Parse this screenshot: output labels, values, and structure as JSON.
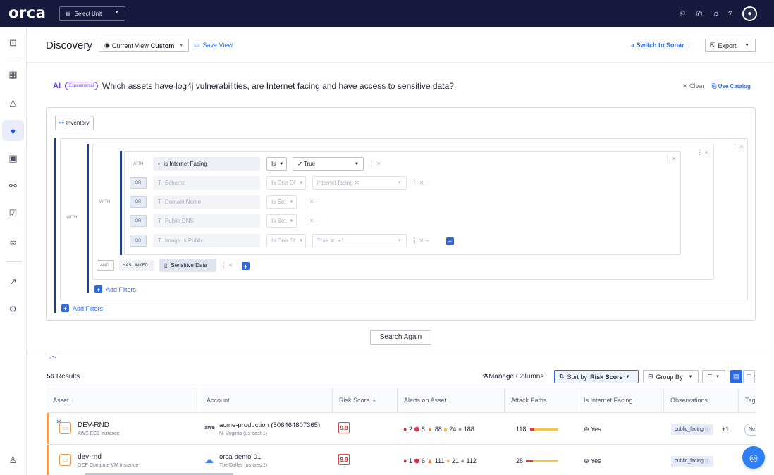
{
  "topbar": {
    "logo": "orca",
    "unit_select": "Select Unit",
    "icons": [
      "flag-icon",
      "megaphone-icon",
      "bell-icon",
      "help-icon",
      "user-avatar-icon"
    ]
  },
  "sidebar": {
    "items": [
      "lock-icon",
      "dashboard-icon",
      "alert-icon",
      "discovery-icon",
      "compliance-icon",
      "graph-icon",
      "clipboard-check-icon",
      "glasses-icon",
      "integrations-icon",
      "settings-icon",
      "user-settings-icon"
    ]
  },
  "header": {
    "title": "Discovery",
    "current_view_label": "Current View",
    "current_view_value": "Custom",
    "save_view": "Save View",
    "switch_to_sonar": "Switch to Sonar",
    "export": "Export"
  },
  "ai": {
    "label": "AI",
    "badge": "Experimental",
    "question": "Which assets have log4j vulnerabilities, are Internet facing and have access to sensitive data?",
    "clear": "Clear",
    "use_catalog": "Use Catalog"
  },
  "filters": {
    "inventory": "Inventory",
    "with": "WITH",
    "or": "OR",
    "and": "AND",
    "has_linked": "HAS LINKED",
    "rows": [
      {
        "field": "Is Internet Facing",
        "operator": "Is",
        "value": "True"
      },
      {
        "field": "Scheme",
        "operator": "Is One Of",
        "value": "internet-facing"
      },
      {
        "field": "Domain Name",
        "operator": "Is Set"
      },
      {
        "field": "Public DNS",
        "operator": "Is Set"
      },
      {
        "field": "Image Is Public",
        "operator": "Is One Of",
        "value": "True",
        "extra": "+1"
      }
    ],
    "linked": "Sensitive Data",
    "add_filters": "Add Filters",
    "search_again": "Search Again"
  },
  "results": {
    "count": "56",
    "label": "Results",
    "manage_columns": "Manage Columns",
    "sort_by_label": "Sort by",
    "sort_by_value": "Risk Score",
    "group_by": "Group By"
  },
  "table": {
    "columns": [
      "Asset",
      "Account",
      "Risk Score",
      "Alerts on Asset",
      "Attack Paths",
      "Is Internet Facing",
      "Observations",
      "Tag"
    ],
    "rows": [
      {
        "asset": "DEV-RND",
        "asset_type": "AWS EC2 Instance",
        "provider": "aws",
        "account": "acme-production (506464807365)",
        "region": "N. Virginia (us-east-1)",
        "risk_score": "9.9",
        "alerts": [
          "2",
          "8",
          "88",
          "24",
          "188"
        ],
        "attack_paths": "118",
        "internet_facing": "Yes",
        "observation": "public_facing",
        "observation_extra": "+1",
        "tag": "No"
      },
      {
        "asset": "dev-rnd",
        "asset_type": "GCP Compute VM Instance",
        "provider": "gcp",
        "account": "orca-demo-01",
        "region": "The Dalles (us-west1)",
        "risk_score": "9.9",
        "alerts": [
          "1",
          "6",
          "111",
          "21",
          "112"
        ],
        "attack_paths": "28",
        "internet_facing": "Yes",
        "observation": "public_facing",
        "observation_extra": "",
        "tag": ""
      }
    ]
  },
  "colors": {
    "topbar": "#17193d",
    "accent": "#2d6ae0",
    "ai": "#6a3fe0",
    "asset_stripe": "#f39c4b"
  }
}
